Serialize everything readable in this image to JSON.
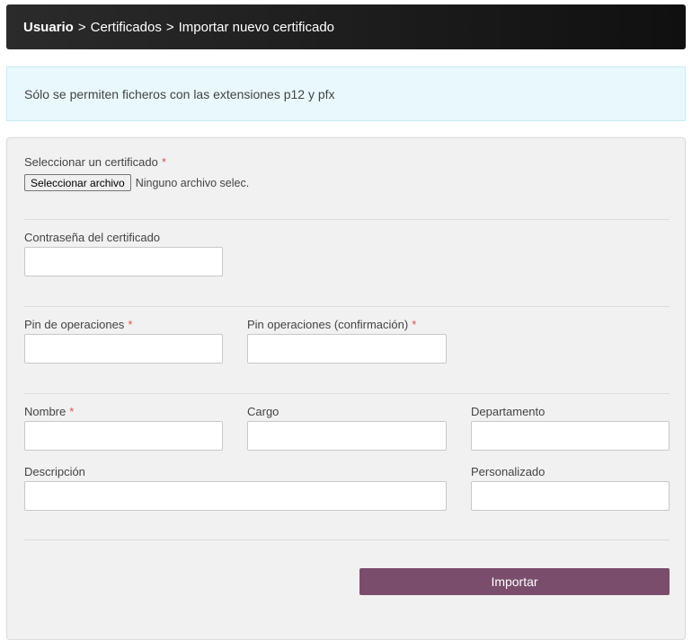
{
  "breadcrumb": {
    "root": "Usuario",
    "separator": ">",
    "level1": "Certificados",
    "level2": "Importar nuevo certificado"
  },
  "info_message": "Sólo se permiten ficheros con las extensiones p12 y pfx",
  "form": {
    "certificate_label": "Seleccionar un certificado",
    "required_mark": "*",
    "file_button": "Seleccionar archivo",
    "file_status": "Ninguno archivo selec.",
    "password_label": "Contraseña del certificado",
    "pin_label": "Pin de operaciones",
    "pin_confirm_label": "Pin operaciones (confirmación)",
    "name_label": "Nombre",
    "position_label": "Cargo",
    "department_label": "Departamento",
    "description_label": "Descripción",
    "custom_label": "Personalizado",
    "submit_label": "Importar"
  },
  "colors": {
    "header_bg": "#1a1a1a",
    "info_bg": "#e9f8fd",
    "panel_bg": "#f1f1f1",
    "submit_bg": "#7a4d6d",
    "required": "#d9534f"
  }
}
